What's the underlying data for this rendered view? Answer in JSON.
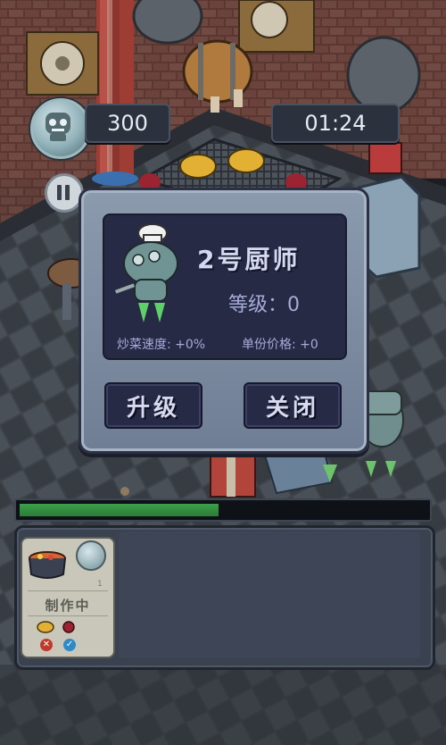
{
  "hud": {
    "coins": "300",
    "timer": "01:24"
  },
  "dialog": {
    "chef_name": "2号厨师",
    "level_text": "等级：0",
    "speed_text": "炒菜速度: +0%",
    "price_text": "单份价格: +0",
    "upgrade_label": "升级",
    "close_label": "关闭"
  },
  "progress": {
    "fraction": 0.49
  },
  "order": {
    "status": "制作中",
    "count": "1",
    "cancel_icon": "cancel-icon",
    "confirm_icon": "confirm-icon"
  },
  "colors": {
    "progress_fill": "#3ca04a",
    "cancel": "#c0392b",
    "confirm": "#2d8ac9"
  }
}
